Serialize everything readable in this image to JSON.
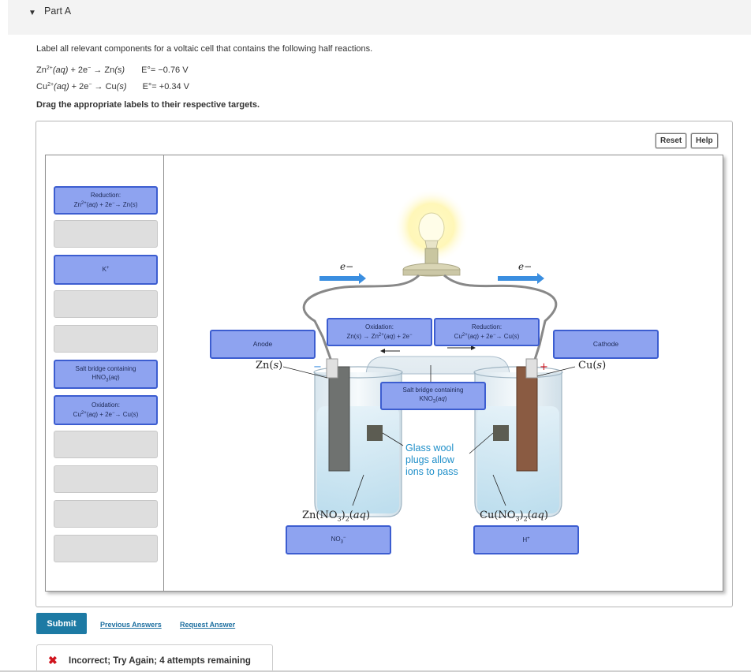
{
  "part": {
    "title": "Part A"
  },
  "question": {
    "prompt": "Label all relevant components for a voltaic cell that contains the following half reactions.",
    "reactions": [
      {
        "ion": "Zn",
        "charge": "2+",
        "state": "(aq)",
        "middle": " + 2e",
        "arrow": " → ",
        "product": "Zn",
        "pstate": "(s)",
        "potential": "E°= −0.76 V"
      },
      {
        "ion": "Cu",
        "charge": "2+",
        "state": "(aq)",
        "middle": " + 2e",
        "arrow": " → ",
        "product": "Cu",
        "pstate": "(s)",
        "potential": "E°= +0.34 V"
      }
    ],
    "instruction": "Drag the appropriate labels to their respective targets."
  },
  "toolbar": {
    "reset": "Reset",
    "help": "Help"
  },
  "bank": {
    "label1_line1": "Reduction:",
    "label1_line2": "Zn2+(aq) + 2e−→ Zn(s)",
    "label2": "K+",
    "label3_line1": "Salt bridge containing",
    "label3_line2": "HNO3(aq)",
    "label4_line1": "Oxidation:",
    "label4_line2": "Cu2+(aq) + 2e−→ Cu(s)"
  },
  "placed": {
    "anode": "Anode",
    "cathode": "Cathode",
    "oxidation_line1": "Oxidation:",
    "oxidation_line2": "Zn(s) → Zn2+(aq) + 2e−",
    "reduction_line1": "Reduction:",
    "reduction_line2": "Cu2+(aq) + 2e−→ Cu(s)",
    "salt_line1": "Salt bridge containing",
    "salt_line2": "KNO3(aq)",
    "left_ion": "NO3−",
    "right_ion": "H+"
  },
  "diagram": {
    "electron": "e−",
    "zn_label": "Zn(s)",
    "cu_label": "Cu(s)",
    "minus": "−",
    "plus": "+",
    "zn_solution": "Zn(NO3)2(aq)",
    "cu_solution": "Cu(NO3)2(aq)",
    "glass_wool": [
      "Glass wool",
      "plugs allow",
      "ions to pass"
    ]
  },
  "actions": {
    "submit": "Submit",
    "previous": "Previous Answers",
    "request": "Request Answer"
  },
  "feedback": {
    "icon": "✖",
    "message": "Incorrect; Try Again; 4 attempts remaining"
  },
  "colors": {
    "label_fill": "#8ea3f0",
    "label_border": "#3c5dd0",
    "submit": "#1d7aa4",
    "error": "#d0141d",
    "glass_wool_text": "#1f8fc9"
  }
}
